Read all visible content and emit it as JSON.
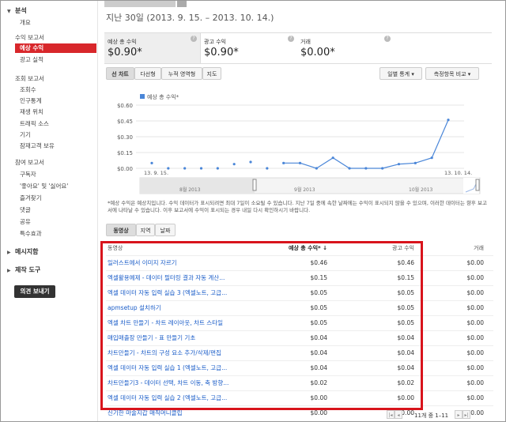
{
  "sidebar": {
    "analysis": "분석",
    "overview": "개요",
    "revenue_reports": "수익 보고서",
    "estimated_revenue": "예상 수익",
    "ad_performance": "광고 실적",
    "views_reports": "조회 보고서",
    "views": "조회수",
    "demographics": "인구통계",
    "playback_locations": "재생 위치",
    "traffic_sources": "트래픽 소스",
    "devices": "기기",
    "audience_retention": "잠재고객 보유",
    "engagement_reports": "참여 보고서",
    "subscribers": "구독자",
    "likes_dislikes": "'좋아요' 및 '싫어요'",
    "favorites": "즐겨찾기",
    "comments": "댓글",
    "sharing": "공유",
    "annotations": "특수효과",
    "inbox": "메시지함",
    "creation_tools": "제작 도구",
    "feedback": "의견 보내기"
  },
  "header": {
    "date_range": "지난 30일 (2013. 9. 15. – 2013. 10. 14.)"
  },
  "metrics": [
    {
      "label": "예상 총 수익",
      "value": "$0.90*"
    },
    {
      "label": "광고 수익",
      "value": "$0.90*"
    },
    {
      "label": "거래",
      "value": "$0.00*"
    }
  ],
  "chart_tabs": [
    "선 차트",
    "다선형",
    "누적 영역형",
    "지도"
  ],
  "controls": {
    "period": "일별 통계",
    "compare": "측정항목 비교"
  },
  "chart_data": {
    "type": "line",
    "series": [
      {
        "name": "예상 총 수익*",
        "color": "#4a86d8"
      }
    ],
    "yticks": [
      "$0.60",
      "$0.45",
      "$0.30",
      "$0.15",
      "$0.00"
    ],
    "ylim": [
      0,
      0.6
    ],
    "x": [
      "13. 9. 15.",
      "13. 9. 20.",
      "13. 9. 25.",
      "13. 9. 29.",
      "13. 9. 30.",
      "13. 10. 1.",
      "13. 10. 2.",
      "13. 10. 3.",
      "13. 10. 4.",
      "13. 10. 5.",
      "13. 10. 6.",
      "13. 10. 7.",
      "13. 10. 8.",
      "13. 10. 9.",
      "13. 10. 10.",
      "13. 10. 11.",
      "13. 10. 12.",
      "13. 10. 13.",
      "13. 10. 14."
    ],
    "values": [
      0.05,
      0.0,
      0.0,
      0.0,
      0.0,
      0.04,
      0.06,
      0.0,
      0.05,
      0.05,
      0.0,
      0.1,
      0.0,
      0.0,
      0.0,
      0.04,
      0.05,
      0.1,
      0.46
    ],
    "x_start_label": "13. 9. 15.",
    "x_end_label": "13. 10. 14.",
    "overview_labels": [
      "8월 2013",
      "9월 2013",
      "10월 2013"
    ]
  },
  "note": "*예상 수익은 예상치입니다. 수익 데이터가 표시되려면 최대 7일이 소요될 수 있습니다. 지난 7일 중에 속한 날짜에는 수익이 표시되지 않을 수 있으며, 이러한 데이터는 향후 보고서에 나타날 수 있습니다. 이후 보고서에 수익이 표시되는 경우 내일 다시 확인하시기 바랍니다.",
  "table_tabs": [
    "동영상",
    "지역",
    "날짜"
  ],
  "table": {
    "headers": [
      "동영상",
      "예상 총 수익* ↓",
      "광고 수익",
      "거래"
    ],
    "rows": [
      {
        "name": "일러스트에서 이미지 자르기",
        "rev": "$0.46",
        "ad": "$0.46",
        "tr": "$0.00"
      },
      {
        "name": "엑셀활용예제 - 데이터 필터링 결과 자동 계산...",
        "rev": "$0.15",
        "ad": "$0.15",
        "tr": "$0.00"
      },
      {
        "name": "엑셀 데이터 자동 입력 실습 3 (엑셀노트, 고급...",
        "rev": "$0.05",
        "ad": "$0.05",
        "tr": "$0.00"
      },
      {
        "name": "apmsetup 설치하기",
        "rev": "$0.05",
        "ad": "$0.05",
        "tr": "$0.00"
      },
      {
        "name": "엑셀 차트 만들기 - 차트 레이아웃, 차트 스타일",
        "rev": "$0.05",
        "ad": "$0.05",
        "tr": "$0.00"
      },
      {
        "name": "매입매출장 만들기 - 표 만들기 기초",
        "rev": "$0.04",
        "ad": "$0.04",
        "tr": "$0.00"
      },
      {
        "name": "차트만들기 - 차트의 구성 요소 추가/삭제/편집",
        "rev": "$0.04",
        "ad": "$0.04",
        "tr": "$0.00"
      },
      {
        "name": "엑셀 데이터 자동 입력 실습 1 (엑셀노트, 고급...",
        "rev": "$0.04",
        "ad": "$0.04",
        "tr": "$0.00"
      },
      {
        "name": "차트만들기3 - 데이터 선택, 차트 이동, 축 방향...",
        "rev": "$0.02",
        "ad": "$0.02",
        "tr": "$0.00"
      },
      {
        "name": "엑셀 데이터 자동 입력 실습 2 (엑셀노트, 고급...",
        "rev": "$0.00",
        "ad": "$0.00",
        "tr": "$0.00"
      },
      {
        "name": "신기한 마술지갑 매직머니클립",
        "rev": "$0.00",
        "ad": "$0.00",
        "tr": "$0.00"
      }
    ]
  },
  "pager": "11개 중 1–11"
}
